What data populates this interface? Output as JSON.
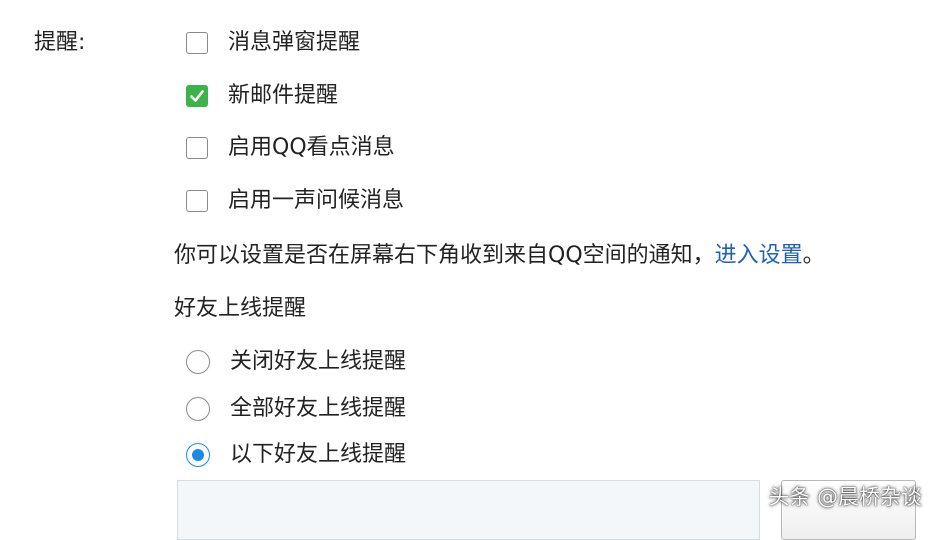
{
  "section": {
    "label": "提醒:"
  },
  "checkboxes": [
    {
      "label": "消息弹窗提醒",
      "checked": false
    },
    {
      "label": "新邮件提醒",
      "checked": true
    },
    {
      "label": "启用QQ看点消息",
      "checked": false
    },
    {
      "label": "启用一声问候消息",
      "checked": false
    }
  ],
  "info": {
    "text": "你可以设置是否在屏幕右下角收到来自QQ空间的通知，",
    "link": "进入设置",
    "end": "。"
  },
  "friend_online": {
    "heading": "好友上线提醒",
    "options": [
      {
        "label": "关闭好友上线提醒",
        "selected": false
      },
      {
        "label": "全部好友上线提醒",
        "selected": false
      },
      {
        "label": "以下好友上线提醒",
        "selected": true
      }
    ]
  },
  "watermark": {
    "text": "头条 @晨桥杂谈"
  },
  "colors": {
    "check_green": "#3cb34a",
    "radio_blue": "#1a8ae6",
    "link_blue": "#1f62b3"
  }
}
